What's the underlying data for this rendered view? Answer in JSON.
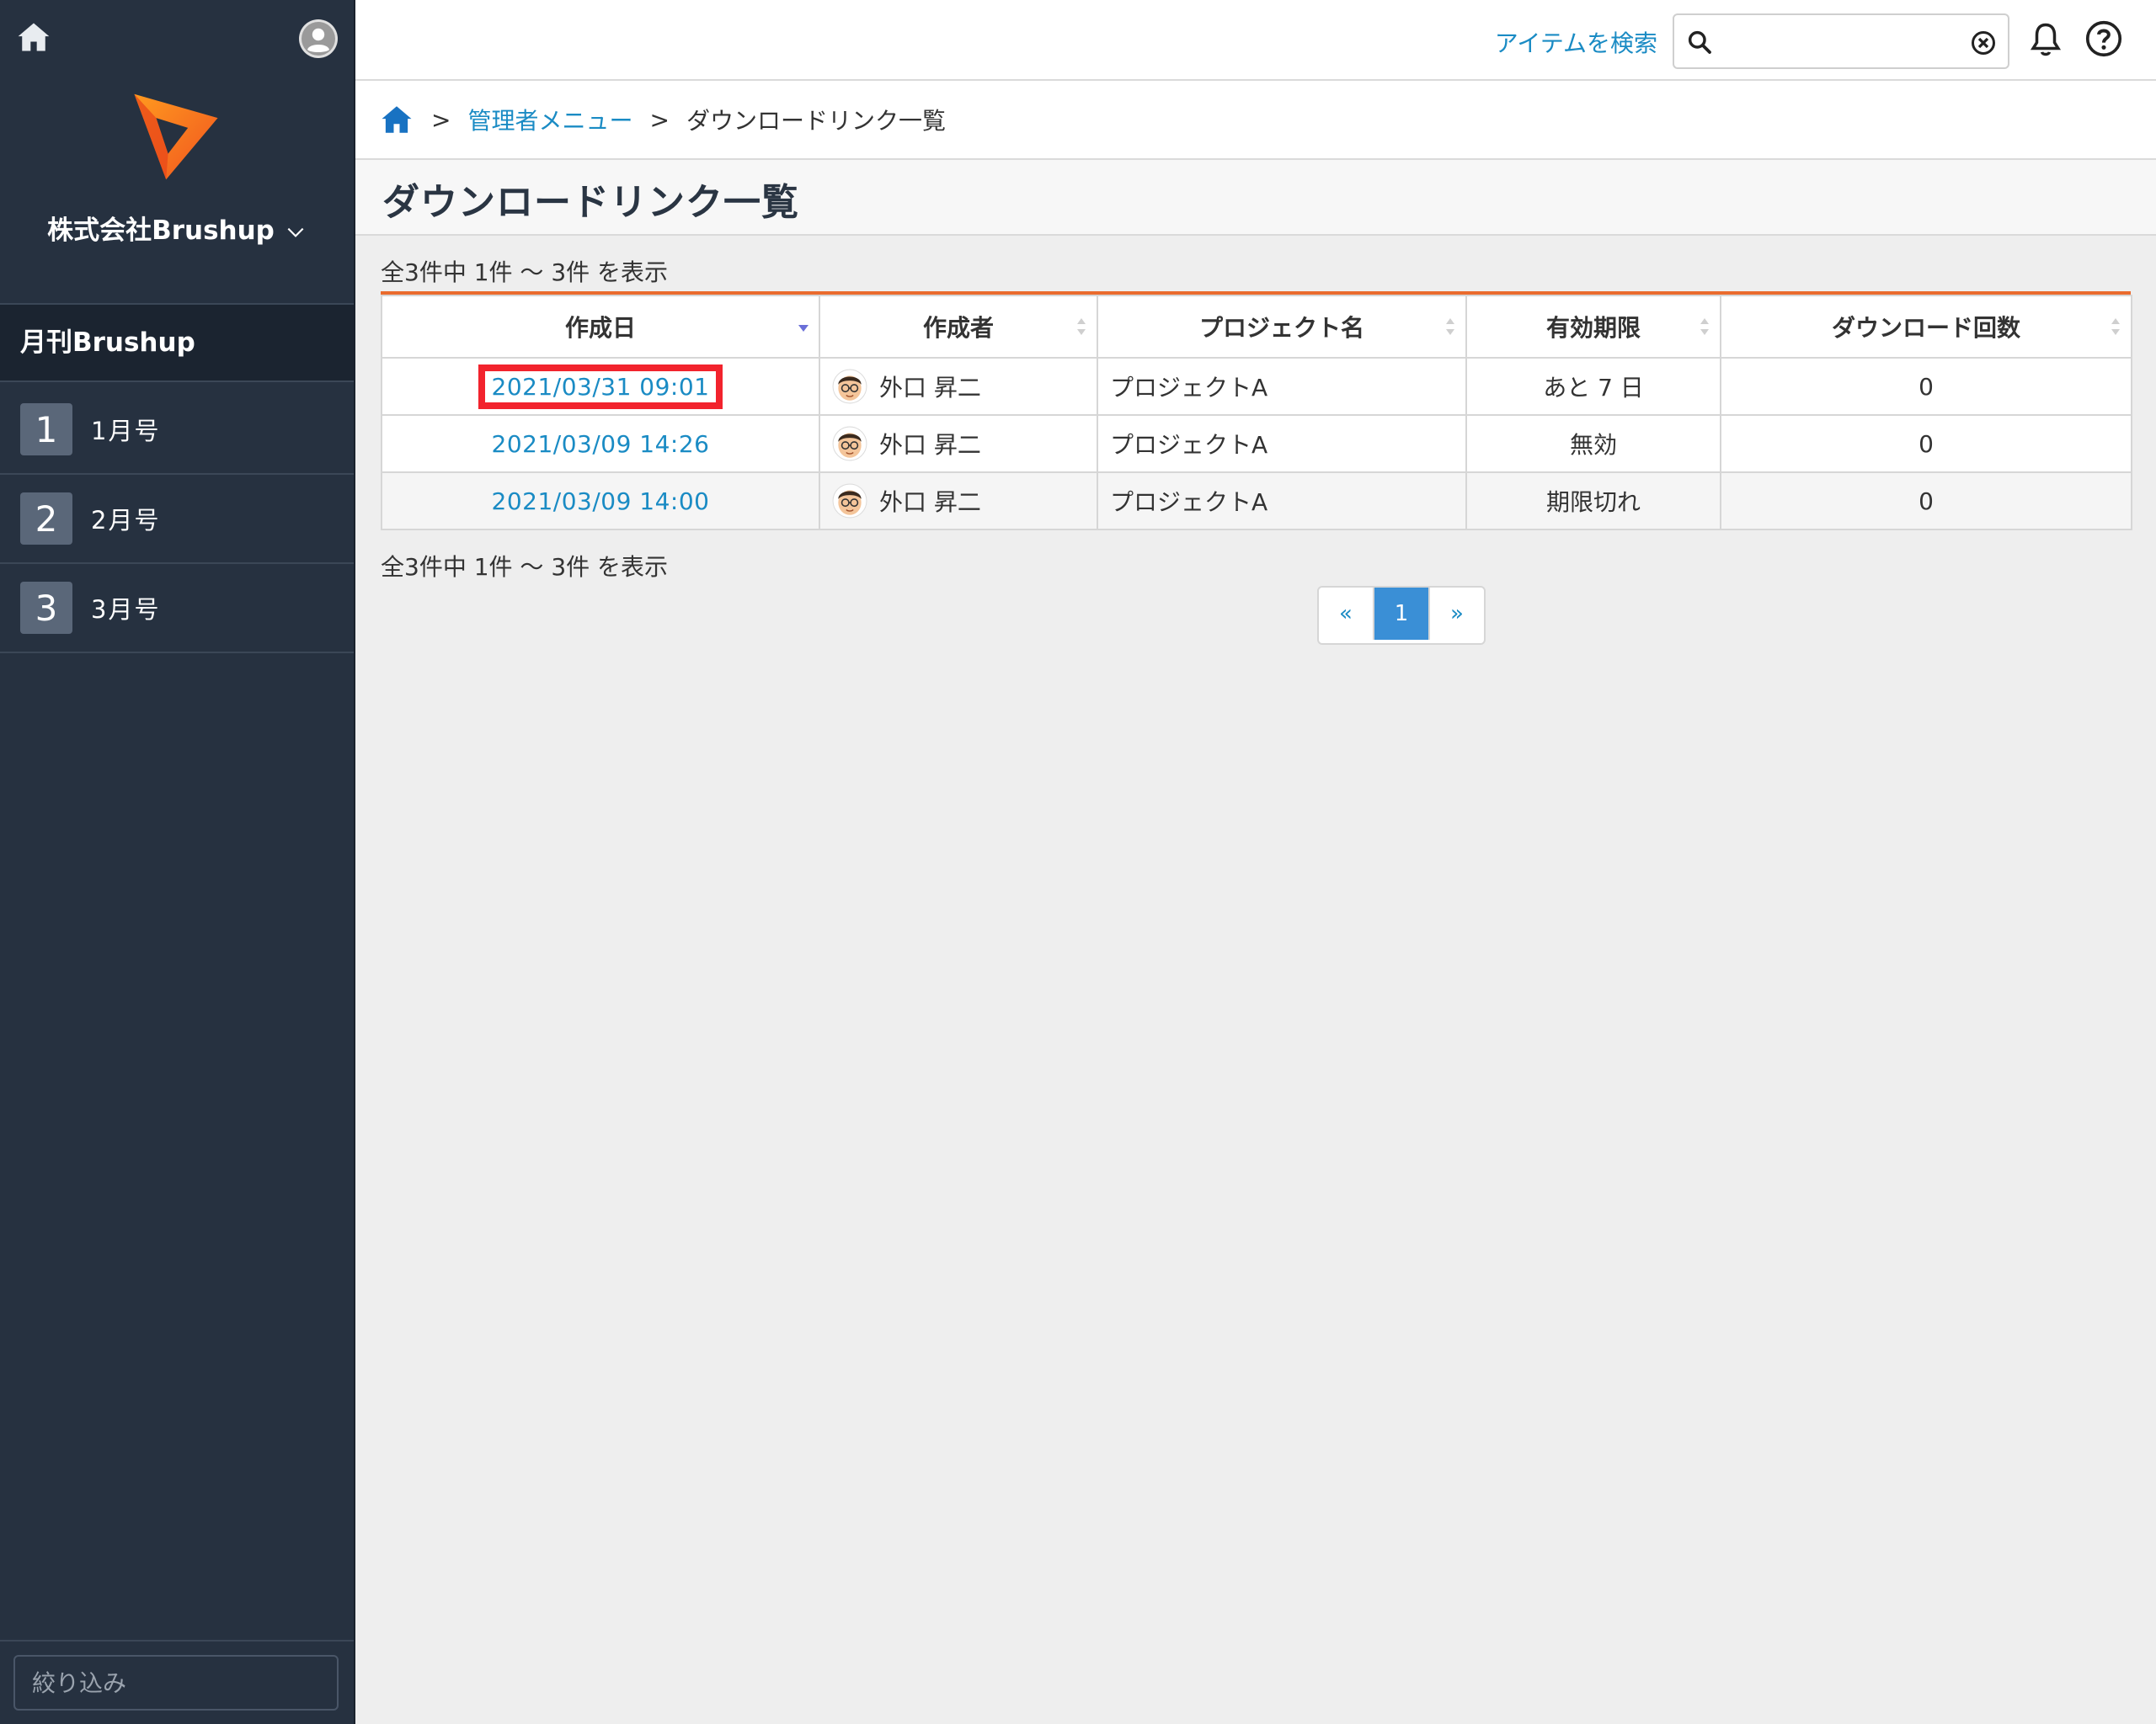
{
  "sidebar": {
    "org_name": "株式会社Brushup",
    "project_name": "月刊Brushup",
    "issues": [
      {
        "num": "1",
        "label": "1月号"
      },
      {
        "num": "2",
        "label": "2月号"
      },
      {
        "num": "3",
        "label": "3月号"
      }
    ],
    "filter_placeholder": "絞り込み"
  },
  "topbar": {
    "search_label": "アイテムを検索",
    "search_value": ""
  },
  "breadcrumb": {
    "sep": ">",
    "admin_menu": "管理者メニュー",
    "current": "ダウンロードリンク一覧"
  },
  "page": {
    "title": "ダウンロードリンク一覧",
    "summary": "全3件中 1件 〜 3件 を表示"
  },
  "table": {
    "headers": [
      "作成日",
      "作成者",
      "プロジェクト名",
      "有効期限",
      "ダウンロード回数"
    ],
    "rows": [
      {
        "date": "2021/03/31 09:01",
        "creator": "外口 昇二",
        "project": "プロジェクトA",
        "expiry": "あと 7 日",
        "downloads": "0"
      },
      {
        "date": "2021/03/09 14:26",
        "creator": "外口 昇二",
        "project": "プロジェクトA",
        "expiry": "無効",
        "downloads": "0"
      },
      {
        "date": "2021/03/09 14:00",
        "creator": "外口 昇二",
        "project": "プロジェクトA",
        "expiry": "期限切れ",
        "downloads": "0"
      }
    ]
  },
  "pagination": {
    "prev": "«",
    "current": "1",
    "next": "»"
  },
  "colors": {
    "sidebar_bg": "#263140",
    "accent_link": "#1a8bc4",
    "table_top_border": "#ea6b2e",
    "highlight": "#f2232d",
    "pagination_active": "#3a8fd6"
  }
}
